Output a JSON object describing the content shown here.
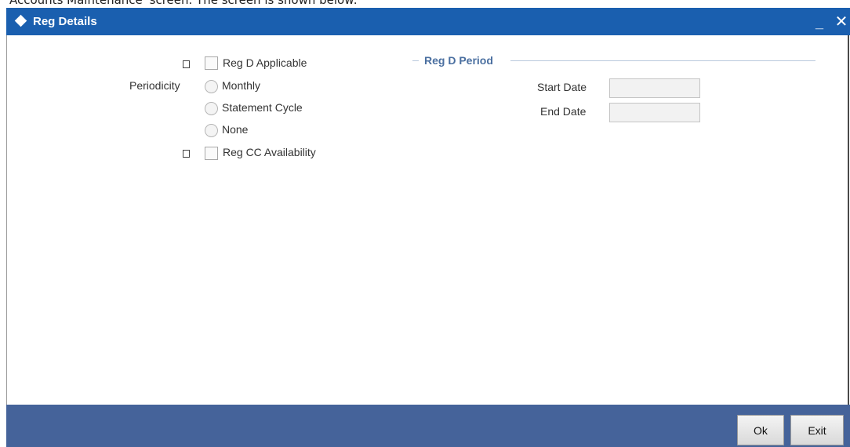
{
  "caption": "Accounts Maintenance' screen. The screen is shown below:",
  "window": {
    "title": "Reg Details",
    "minimize_glyph": "_",
    "close_glyph": "✕"
  },
  "form": {
    "reg_d_applicable": {
      "label": "Reg D Applicable",
      "checked": false
    },
    "periodicity": {
      "label": "Periodicity",
      "options": [
        "Monthly",
        "Statement Cycle",
        "None"
      ],
      "selected": null
    },
    "reg_cc_availability": {
      "label": "Reg CC Availability",
      "checked": false
    }
  },
  "reg_d_period": {
    "legend": "Reg D Period",
    "start_date": {
      "label": "Start Date",
      "value": ""
    },
    "end_date": {
      "label": "End Date",
      "value": ""
    }
  },
  "footer": {
    "ok_label": "Ok",
    "exit_label": "Exit"
  },
  "colors": {
    "titlebar": "#1a5faf",
    "footer": "#45639a",
    "legend": "#4a6fa0"
  }
}
